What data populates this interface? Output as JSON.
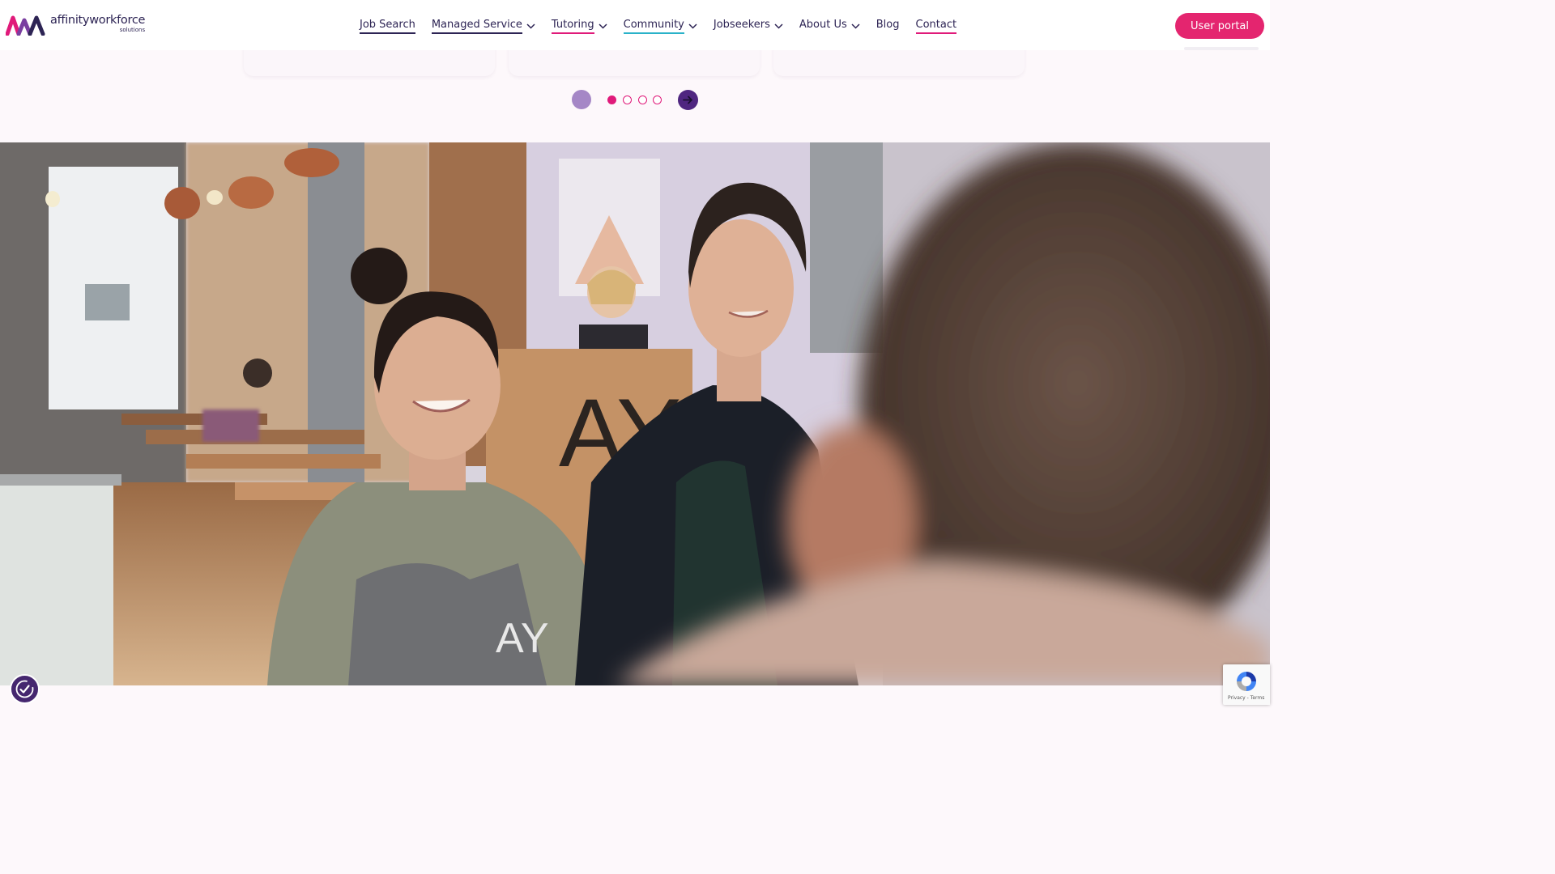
{
  "header": {
    "logo_name": "affinityworkforce",
    "logo_sub": "solutions",
    "nav": [
      {
        "label": "Job Search",
        "dropdown": false
      },
      {
        "label": "Managed Service",
        "dropdown": true
      },
      {
        "label": "Tutoring",
        "dropdown": true
      },
      {
        "label": "Community",
        "dropdown": true
      },
      {
        "label": "Jobseekers",
        "dropdown": true
      },
      {
        "label": "About Us",
        "dropdown": true
      },
      {
        "label": "Blog",
        "dropdown": false
      },
      {
        "label": "Contact",
        "dropdown": false
      }
    ],
    "user_portal_label": "User portal"
  },
  "carousel": {
    "slide_count": 4,
    "active_index": 0
  },
  "video": {
    "apron_logo": "AY",
    "bag_logo": "AY"
  },
  "recaptcha": {
    "links": "Privacy - Terms"
  },
  "colors": {
    "brand_pink": "#e4256f",
    "brand_purple": "#4f2680",
    "navy": "#2d2454",
    "teal": "#2ab2c9"
  },
  "icons": {
    "nav_dropdown": "chevron-down-icon",
    "carousel_next": "arrow-right-icon",
    "accessibility": "accessibility-icon",
    "recaptcha": "recaptcha-icon"
  }
}
